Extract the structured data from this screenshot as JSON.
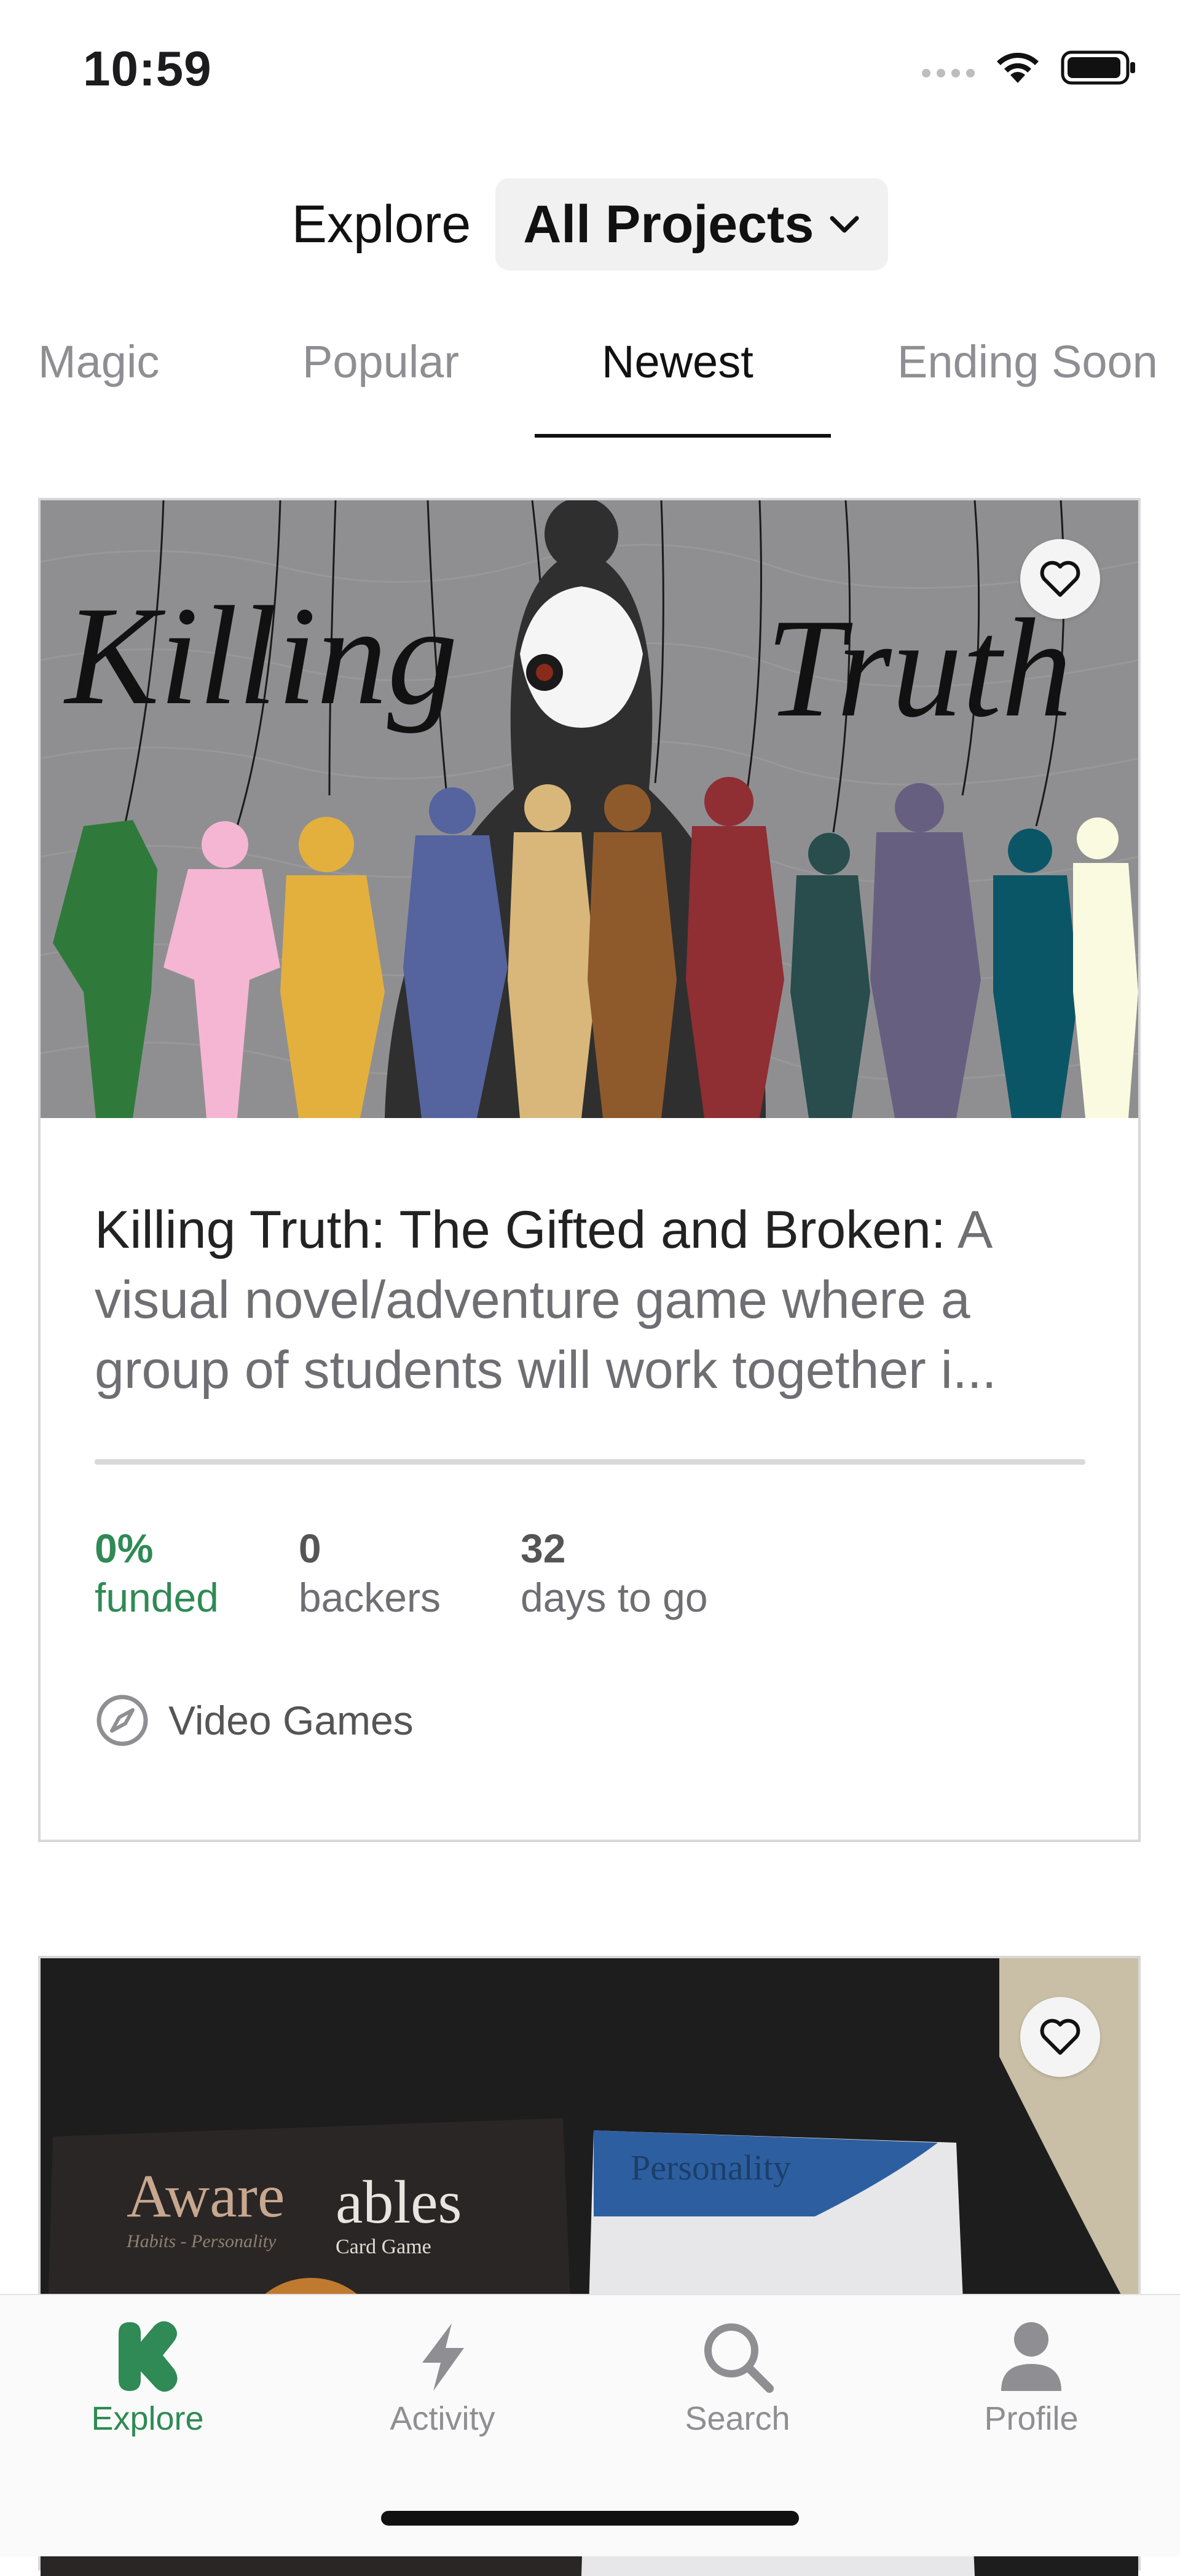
{
  "status_bar": {
    "time": "10:59"
  },
  "header": {
    "title": "Explore",
    "filter_label": "All Projects"
  },
  "tabs": [
    {
      "label": "Magic"
    },
    {
      "label": "Popular"
    },
    {
      "label": "Newest",
      "active": true
    },
    {
      "label": "Ending Soon"
    }
  ],
  "projects": [
    {
      "name": "Killing Truth: The Gifted and Broken:",
      "blurb": "A visual novel/adventure game where a group of students will work together i...",
      "image_text_left": "Killing",
      "image_text_right": "Truth",
      "funded_percent": 0,
      "funded_value": "0%",
      "funded_label": "funded",
      "backers_value": "0",
      "backers_label": "backers",
      "days_value": "32",
      "days_label": "days to go",
      "category": "Video Games"
    },
    {
      "image_text_title": "Aware",
      "image_text_title2": "ables",
      "image_text_sub": "Habits - Personality",
      "image_text_sub2": "Card Game",
      "image_text_card": "Personality"
    }
  ],
  "tab_bar": {
    "items": [
      {
        "label": "Explore",
        "icon": "kickstarter-k-icon",
        "active": true
      },
      {
        "label": "Activity",
        "icon": "lightning-icon"
      },
      {
        "label": "Search",
        "icon": "search-icon"
      },
      {
        "label": "Profile",
        "icon": "person-icon"
      }
    ]
  },
  "colors": {
    "accent": "#2f8a55",
    "progress": "#05ce78"
  }
}
